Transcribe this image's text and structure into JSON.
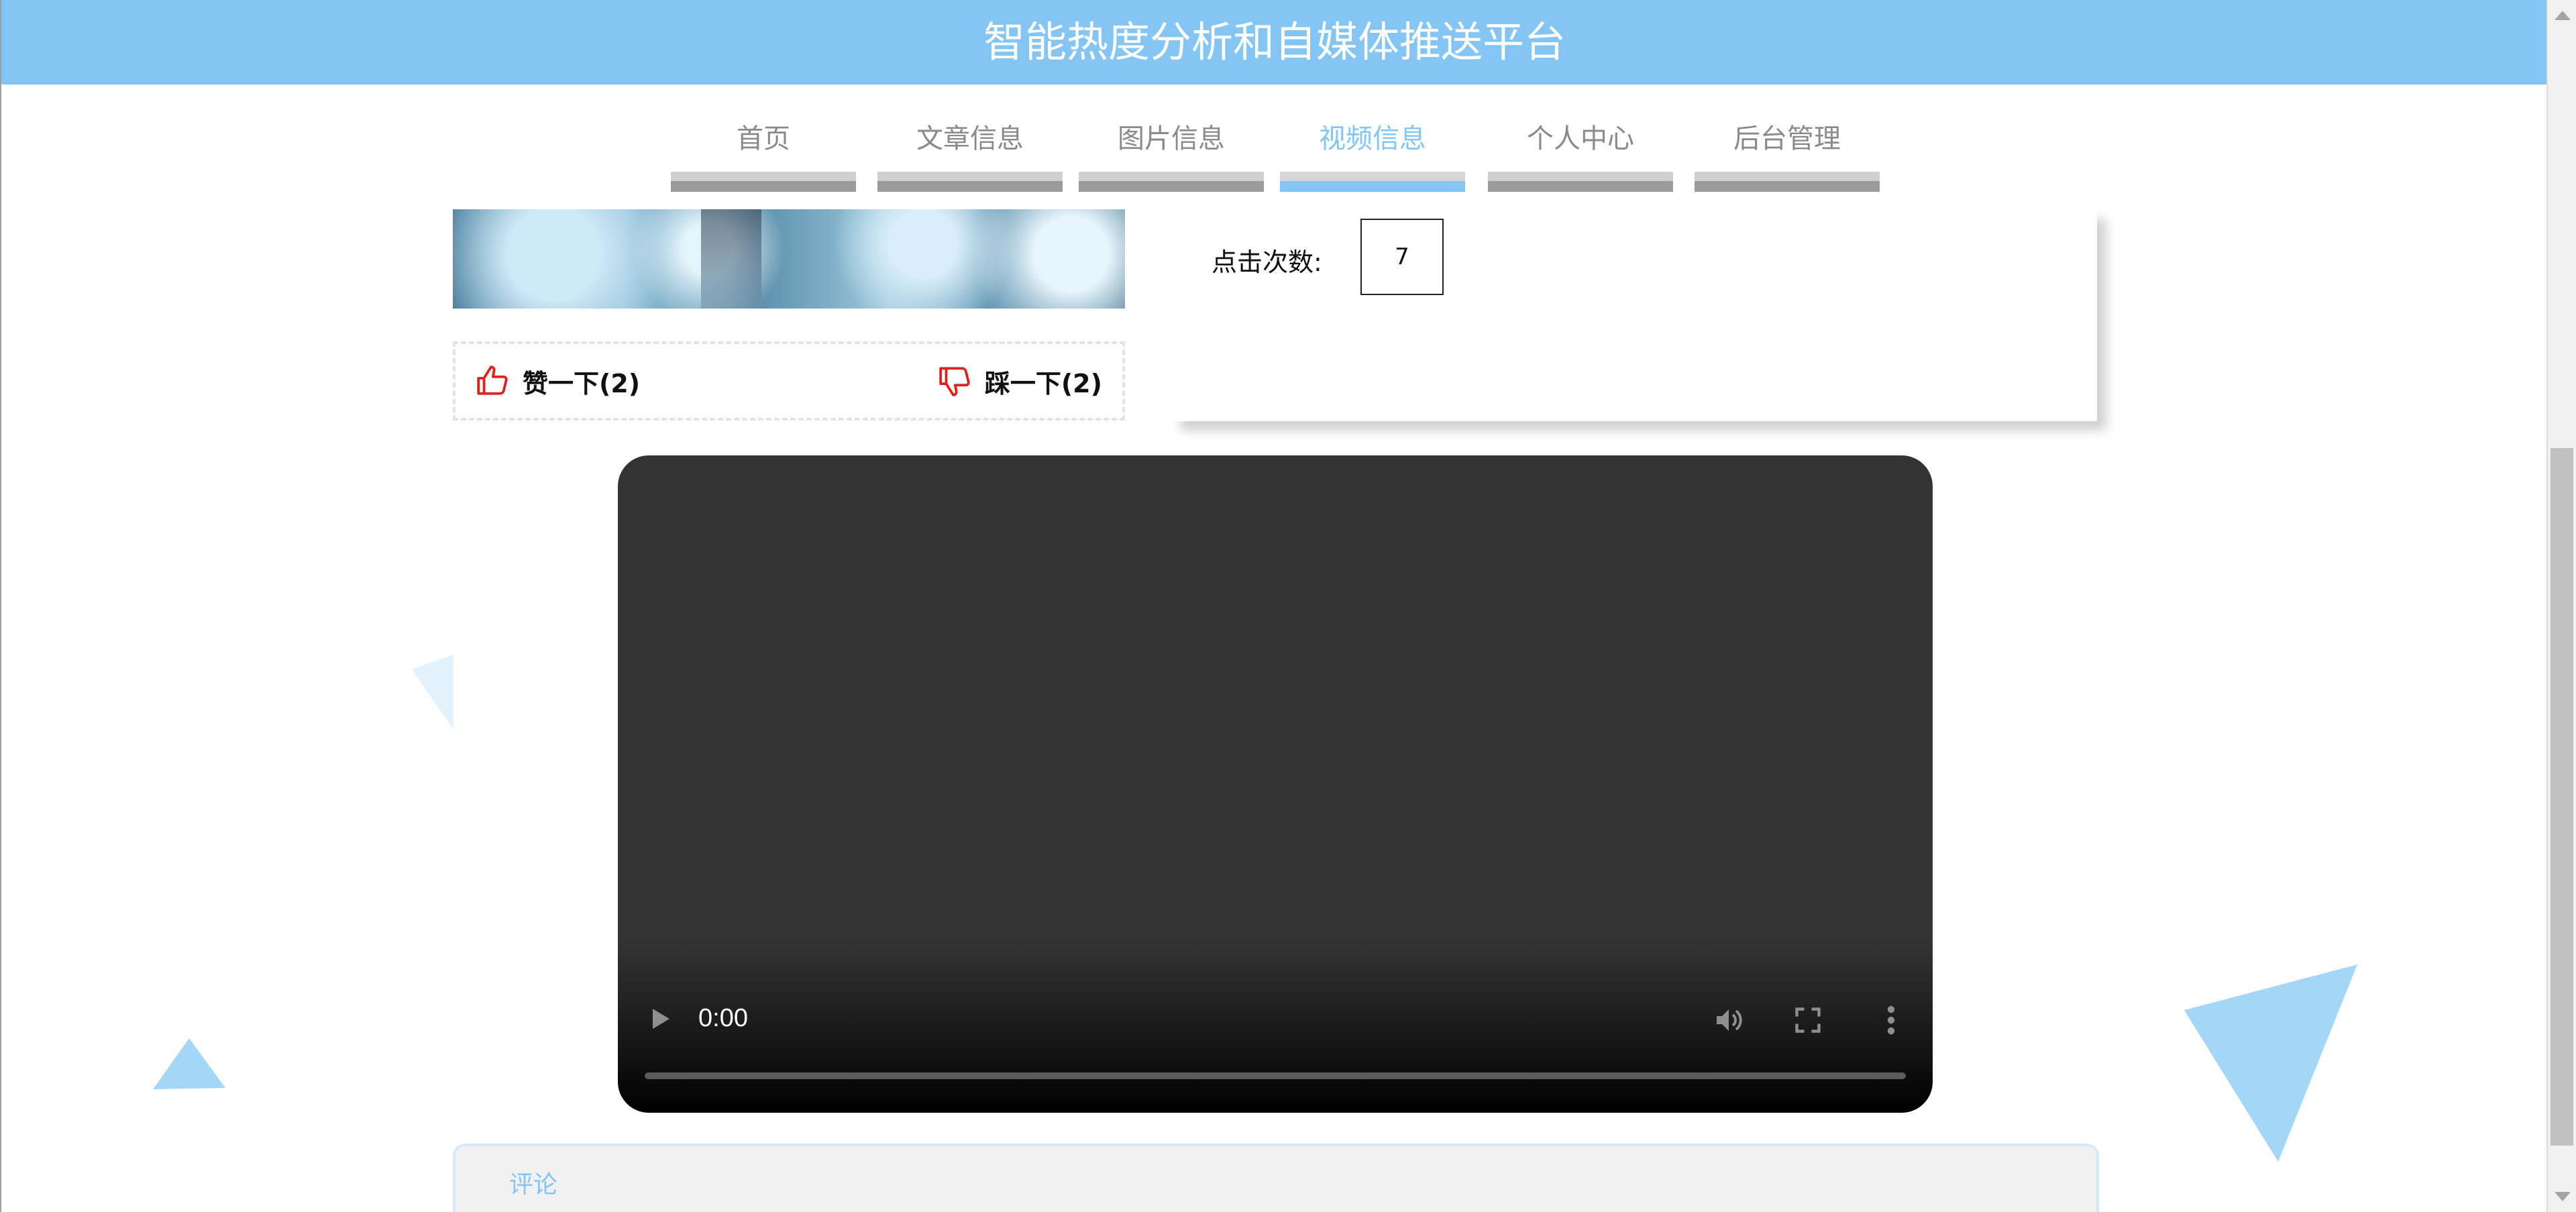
{
  "header": {
    "title": "智能热度分析和自媒体推送平台"
  },
  "nav": {
    "items": [
      {
        "label": "首页",
        "active": false
      },
      {
        "label": "文章信息",
        "active": false
      },
      {
        "label": "图片信息",
        "active": false
      },
      {
        "label": "视频信息",
        "active": true
      },
      {
        "label": "个人中心",
        "active": false
      },
      {
        "label": "后台管理",
        "active": false
      }
    ]
  },
  "detail": {
    "click_count_label": "点击次数:",
    "click_count_value": "7",
    "like_label": "赞一下(2)",
    "dislike_label": "踩一下(2)"
  },
  "video": {
    "time": "0:00"
  },
  "comments": {
    "title": "评论"
  },
  "colors": {
    "accent": "#84c5f3",
    "like": "#e0201a",
    "video_bg": "#333333"
  },
  "icons": {
    "like": "thumbs-up-icon",
    "dislike": "thumbs-down-icon",
    "play": "play-icon",
    "volume": "volume-icon",
    "fullscreen": "fullscreen-icon",
    "more": "more-vertical-icon"
  }
}
